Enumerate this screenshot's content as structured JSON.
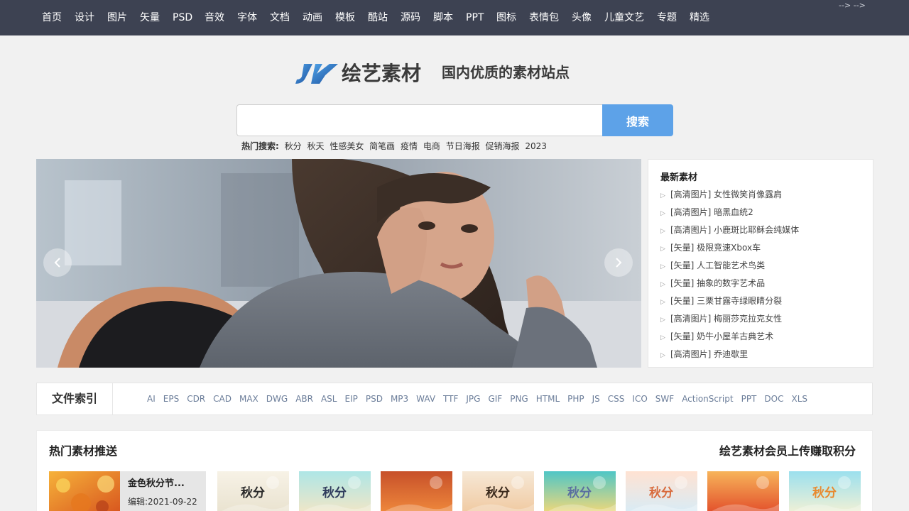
{
  "topnav": {
    "items": [
      "首页",
      "设计",
      "图片",
      "矢量",
      "PSD",
      "音效",
      "字体",
      "文档",
      "动画",
      "模板",
      "酷站",
      "源码",
      "脚本",
      "PPT",
      "图标",
      "表情包",
      "头像",
      "儿童文艺",
      "专题",
      "精选"
    ],
    "stray_text": "--> -->"
  },
  "logo": {
    "icon": "hy-logo-icon",
    "name": "绘艺素材",
    "slogan": "国内优质的素材站点"
  },
  "search": {
    "value": "",
    "placeholder": "",
    "button_label": "搜索",
    "hot_label": "热门搜索:",
    "hot_terms": [
      "秋分",
      "秋天",
      "性感美女",
      "简笔画",
      "疫情",
      "电商",
      "节日海报",
      "促销海报",
      "2023"
    ]
  },
  "banner": {
    "image": "woman-in-grey-sweater-photo",
    "prev_icon": "chevron-left-icon",
    "next_icon": "chevron-right-icon"
  },
  "latest": {
    "title": "最新素材",
    "items": [
      "[高清图片] 女性微笑肖像露肩",
      "[高清图片] 暗黑血统2",
      "[高清图片] 小鹿斑比耶稣会纯媒体",
      "[矢量] 极限竞速Xbox车",
      "[矢量] 人工智能艺术鸟类",
      "[矢量] 抽象的数字艺术品",
      "[矢量] 三栗甘露寺绿眼睛分裂",
      "[高清图片] 梅丽莎克拉克女性",
      "[矢量] 奶牛小屋羊古典艺术",
      "[高清图片] 乔迪歇里"
    ]
  },
  "file_index": {
    "title": "文件索引",
    "formats": [
      "AI",
      "EPS",
      "CDR",
      "CAD",
      "MAX",
      "DWG",
      "ABR",
      "ASL",
      "EIP",
      "PSD",
      "MP3",
      "WAV",
      "TTF",
      "JPG",
      "GIF",
      "PNG",
      "HTML",
      "PHP",
      "JS",
      "CSS",
      "ICO",
      "SWF",
      "ActionScript",
      "PPT",
      "DOC",
      "XLS"
    ]
  },
  "hot": {
    "title": "热门素材推送",
    "right_link": "绘艺素材会员上传赚取积分",
    "featured": {
      "title": "金色秋分节...",
      "meta": "编辑:2021-09-22"
    },
    "tiles": [
      {
        "text": "秋分",
        "colors": [
          "#f7f2e6",
          "#e9e2cf"
        ],
        "text_color": "#2b2b2b"
      },
      {
        "text": "秋分",
        "colors": [
          "#aee6e6",
          "#f2e6c6"
        ],
        "text_color": "#2f3b5c"
      },
      {
        "text": "",
        "colors": [
          "#c7502a",
          "#f08a3c"
        ],
        "text_color": "#ffffff"
      },
      {
        "text": "秋分",
        "colors": [
          "#f6e8d6",
          "#f0c9a0"
        ],
        "text_color": "#3a2a1c"
      },
      {
        "text": "秋分",
        "colors": [
          "#4fc6c6",
          "#f4d878"
        ],
        "text_color": "#5a6ea0"
      },
      {
        "text": "秋分",
        "colors": [
          "#ffe2d2",
          "#d7ecf7"
        ],
        "text_color": "#d86a3c"
      },
      {
        "text": "",
        "colors": [
          "#f7b45a",
          "#e24d2a"
        ],
        "text_color": "#ffffff"
      },
      {
        "text": "秋分",
        "colors": [
          "#9be0ee",
          "#f3f1d5"
        ],
        "text_color": "#e8892e"
      }
    ]
  }
}
